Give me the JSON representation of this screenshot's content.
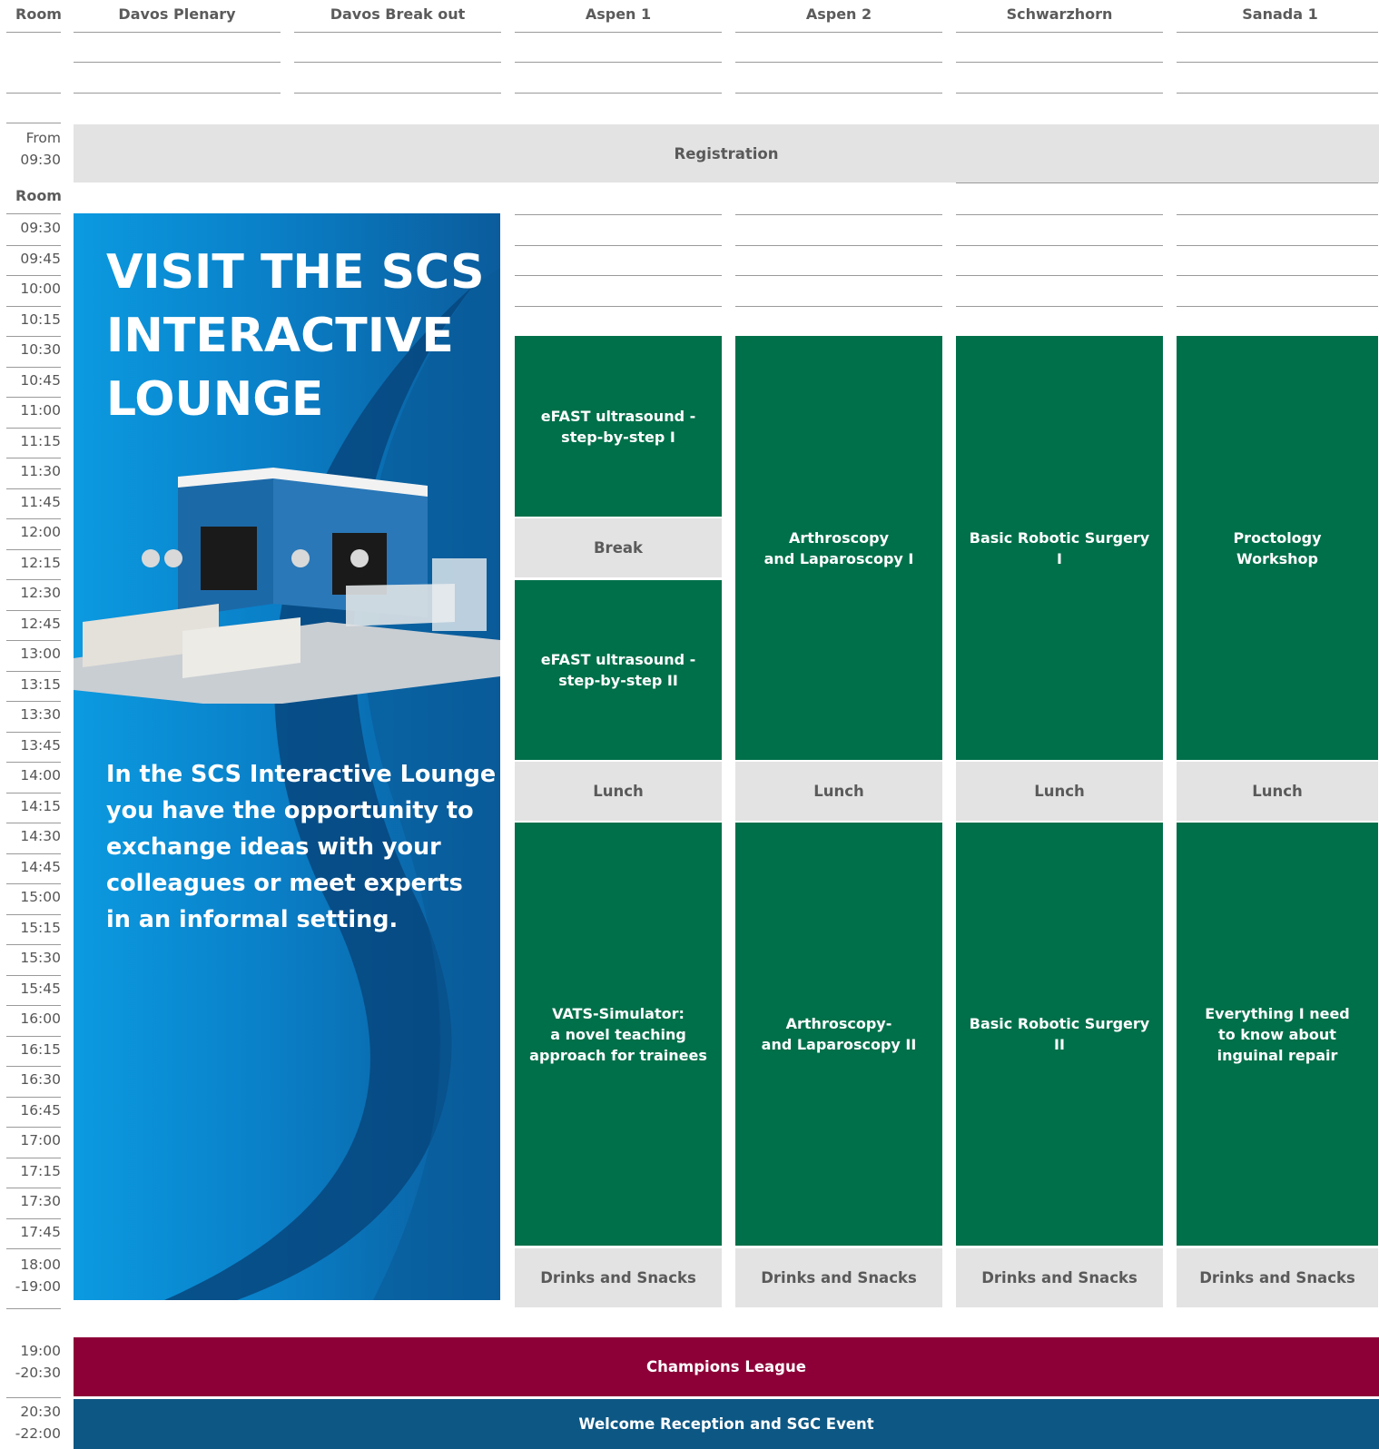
{
  "header": {
    "room_label": "Room",
    "rooms": [
      "Davos Plenary",
      "Davos Break out",
      "Aspen 1",
      "Aspen 2",
      "Schwarzhorn",
      "Sanada 1"
    ]
  },
  "registration": {
    "time": "From\n09:30",
    "label": "Registration"
  },
  "second_room_label": "Room",
  "times": [
    "09:30",
    "09:45",
    "10:00",
    "10:15",
    "10:30",
    "10:45",
    "11:00",
    "11:15",
    "11:30",
    "11:45",
    "12:00",
    "12:15",
    "12:30",
    "12:45",
    "13:00",
    "13:15",
    "13:30",
    "13:45",
    "14:00",
    "14:15",
    "14:30",
    "14:45",
    "15:00",
    "15:15",
    "15:30",
    "15:45",
    "16:00",
    "16:15",
    "16:30",
    "16:45",
    "17:00",
    "17:15",
    "17:30",
    "17:45",
    "18:00\n-19:00"
  ],
  "promo": {
    "title": "VISIT THE SCS\nINTERACTIVE\nLOUNGE",
    "body": "In the SCS Interactive Lounge\nyou have the opportunity to\nexchange ideas with your\ncolleagues or meet experts\nin an informal setting.",
    "colors": {
      "light": "#0b9ae0",
      "dark": "#0b5c9c"
    }
  },
  "sessions": {
    "aspen1": {
      "s1": "eFAST ultrasound -\nstep-by-step I",
      "break": "Break",
      "s2": "eFAST ultrasound -\nstep-by-step II",
      "lunch": "Lunch",
      "s3": "VATS-Simulator:\na novel teaching\napproach for trainees",
      "drinks": "Drinks and Snacks"
    },
    "aspen2": {
      "s1": "Arthroscopy\nand Laparoscopy I",
      "lunch": "Lunch",
      "s2": "Arthroscopy-\nand Laparoscopy II",
      "drinks": "Drinks and Snacks"
    },
    "schwarzhorn": {
      "s1": "Basic Robotic Surgery I",
      "lunch": "Lunch",
      "s2": "Basic Robotic Surgery II",
      "drinks": "Drinks and Snacks"
    },
    "sanada1": {
      "s1": "Proctology\nWorkshop",
      "lunch": "Lunch",
      "s2": "Everything I need\nto know about\ninguinal repair",
      "drinks": "Drinks and Snacks"
    }
  },
  "evening": [
    {
      "time": "19:00\n-20:30",
      "label": "Champions League",
      "color": "#8c0037"
    },
    {
      "time": "20:30\n-22:00",
      "label": "Welcome Reception and SGC Event",
      "color": "#0d5784"
    }
  ],
  "colors": {
    "session_green": "#00704a",
    "break_grey": "#e3e3e3"
  }
}
